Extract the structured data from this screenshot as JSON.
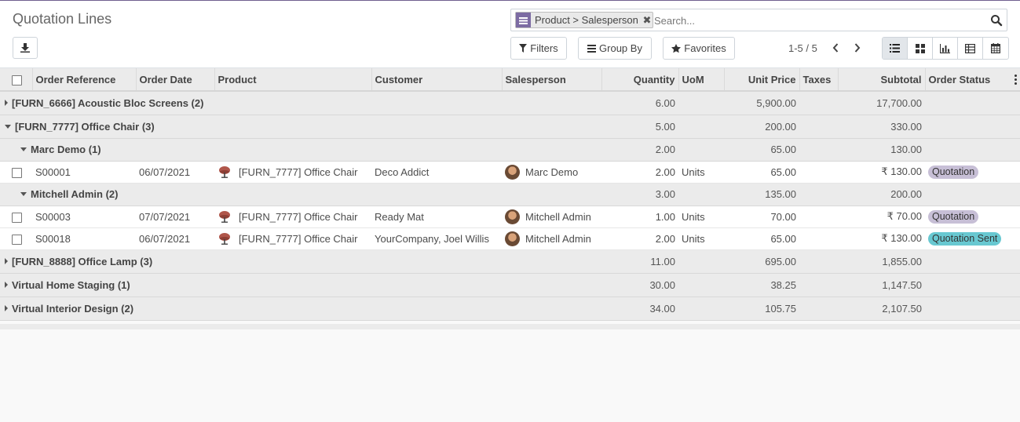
{
  "title": "Quotation Lines",
  "search": {
    "facet": "Product > Salesperson",
    "placeholder": "Search..."
  },
  "toolbar": {
    "filters": "Filters",
    "group_by": "Group By",
    "favorites": "Favorites"
  },
  "pager": "1-5 / 5",
  "views": [
    "list-icon",
    "kanban-icon",
    "graph-icon",
    "pivot-icon",
    "calendar-icon"
  ],
  "columns": {
    "order_reference": "Order Reference",
    "order_date": "Order Date",
    "product": "Product",
    "customer": "Customer",
    "salesperson": "Salesperson",
    "quantity": "Quantity",
    "uom": "UoM",
    "unit_price": "Unit Price",
    "taxes": "Taxes",
    "subtotal": "Subtotal",
    "order_status": "Order Status"
  },
  "groups": [
    {
      "name": "[FURN_6666] Acoustic Bloc Screens (2)",
      "quantity": "6.00",
      "unit_price": "5,900.00",
      "subtotal": "17,700.00"
    },
    {
      "name": "[FURN_7777] Office Chair (3)",
      "quantity": "5.00",
      "unit_price": "200.00",
      "subtotal": "330.00"
    },
    {
      "name": "[FURN_8888] Office Lamp (3)",
      "quantity": "11.00",
      "unit_price": "695.00",
      "subtotal": "1,855.00"
    },
    {
      "name": "Virtual Home Staging (1)",
      "quantity": "30.00",
      "unit_price": "38.25",
      "subtotal": "1,147.50"
    },
    {
      "name": "Virtual Interior Design (2)",
      "quantity": "34.00",
      "unit_price": "105.75",
      "subtotal": "2,107.50"
    }
  ],
  "subgroups": [
    {
      "name": "Marc Demo (1)",
      "quantity": "2.00",
      "unit_price": "65.00",
      "subtotal": "130.00"
    },
    {
      "name": "Mitchell Admin (2)",
      "quantity": "3.00",
      "unit_price": "135.00",
      "subtotal": "200.00"
    }
  ],
  "records": [
    {
      "ref": "S00001",
      "date": "06/07/2021",
      "product": "[FURN_7777] Office Chair",
      "customer": "Deco Addict",
      "salesperson": "Marc Demo",
      "quantity": "2.00",
      "uom": "Units",
      "unit_price": "65.00",
      "taxes": "",
      "subtotal": "₹ 130.00",
      "status": "Quotation"
    },
    {
      "ref": "S00003",
      "date": "07/07/2021",
      "product": "[FURN_7777] Office Chair",
      "customer": "Ready Mat",
      "salesperson": "Mitchell Admin",
      "quantity": "1.00",
      "uom": "Units",
      "unit_price": "70.00",
      "taxes": "",
      "subtotal": "₹ 70.00",
      "status": "Quotation"
    },
    {
      "ref": "S00018",
      "date": "06/07/2021",
      "product": "[FURN_7777] Office Chair",
      "customer": "YourCompany, Joel Willis",
      "salesperson": "Mitchell Admin",
      "quantity": "2.00",
      "uom": "Units",
      "unit_price": "65.00",
      "taxes": "",
      "subtotal": "₹ 130.00",
      "status": "Quotation Sent"
    }
  ],
  "colors": {
    "brand": "#7c6ba3",
    "badge_quotation": "#c7bfd6",
    "badge_sent": "#68c8d1"
  }
}
